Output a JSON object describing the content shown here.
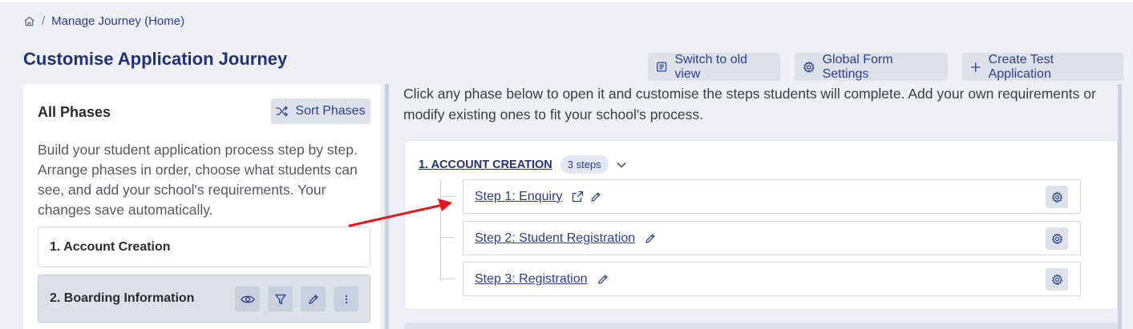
{
  "breadcrumb": {
    "home_icon": "home-icon",
    "separator": "/",
    "current": "Manage Journey (Home)"
  },
  "page": {
    "title": "Customise Application Journey"
  },
  "toolbar": {
    "switch_view": "Switch to old view",
    "global_settings": "Global Form Settings",
    "create_test": "Create Test Application"
  },
  "left_panel": {
    "title": "All Phases",
    "sort_button": "Sort Phases",
    "description": "Build your student application process step by step. Arrange phases in order, choose what students can see, and add your school's requirements. Your changes save automatically.",
    "phases": [
      {
        "label": "1. Account Creation"
      },
      {
        "label": "2. Boarding Information",
        "actions": [
          "eye-icon",
          "filter-icon",
          "pencil-icon",
          "more-icon"
        ]
      }
    ]
  },
  "main": {
    "intro": "Click any phase below to open it and customise the steps students will complete. Add your own requirements or modify existing ones to fit your school's process.",
    "phase_card": {
      "title": "1. ACCOUNT CREATION",
      "badge": "3 steps",
      "steps": [
        {
          "label": "Step 1: Enquiry"
        },
        {
          "label": "Step 2: Student Registration"
        },
        {
          "label": "Step 3: Registration"
        }
      ]
    }
  },
  "colors": {
    "brand": "#23307a",
    "link": "#2c3e8f",
    "button_bg": "#dde1ea",
    "page_bg": "#eef0f6",
    "annotation_arrow": "#e8141c"
  }
}
